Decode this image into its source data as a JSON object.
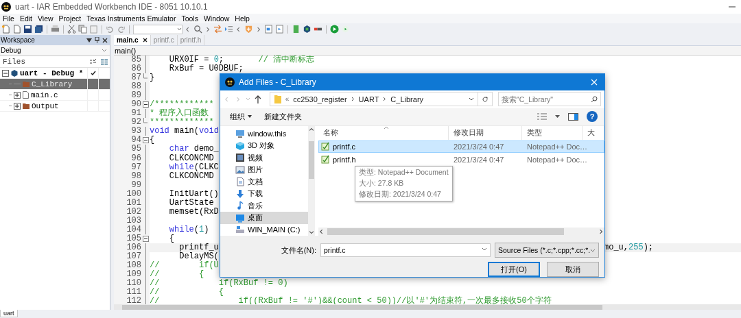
{
  "window": {
    "title": "uart - IAR Embedded Workbench IDE - 8051 10.10.1"
  },
  "menu": [
    "File",
    "Edit",
    "View",
    "Project",
    "Texas Instruments Emulator",
    "Tools",
    "Window",
    "Help"
  ],
  "workspace": {
    "title": "Workspace",
    "configuration": "Debug",
    "files_header": "Files",
    "tree": [
      {
        "label": "uart - Debug *",
        "kind": "project",
        "selected": false,
        "checked": true,
        "expanded": true,
        "children": [
          {
            "label": "C_Library",
            "kind": "folder",
            "selected": true,
            "checked": false
          },
          {
            "label": "main.c",
            "kind": "file",
            "selected": false,
            "checked": false,
            "expanded": false
          },
          {
            "label": "Output",
            "kind": "folder",
            "selected": false,
            "checked": false,
            "expanded": false
          }
        ]
      }
    ]
  },
  "editor": {
    "tabs": [
      {
        "label": "main.c",
        "selected": true
      },
      {
        "label": "printf.c",
        "selected": false
      },
      {
        "label": "printf.h",
        "selected": false
      }
    ],
    "function": "main()",
    "lines": [
      {
        "number": "85",
        "current": false,
        "fold_open": false,
        "fold_end": false,
        "segments": [
          {
            "text": "    URX0IF = ",
            "kind": "code"
          },
          {
            "text": "0",
            "kind": "number"
          },
          {
            "text": ";",
            "kind": "code"
          },
          {
            "text": "       // 清中断标志",
            "kind": "comment"
          }
        ]
      },
      {
        "number": "86",
        "current": false,
        "fold_open": false,
        "fold_end": false,
        "segments": [
          {
            "text": "    RxBuf = U0DBUF;",
            "kind": "code"
          }
        ]
      },
      {
        "number": "87",
        "current": false,
        "fold_open": false,
        "fold_end": true,
        "segments": [
          {
            "text": "}",
            "kind": "code"
          }
        ]
      },
      {
        "number": "88",
        "current": false,
        "fold_open": false,
        "fold_end": false
      },
      {
        "number": "89",
        "current": false,
        "fold_open": false,
        "fold_end": false
      },
      {
        "number": "90",
        "current": false,
        "fold_open": true,
        "fold_end": false,
        "segments": [
          {
            "text": "/************",
            "kind": "comment"
          }
        ]
      },
      {
        "number": "91",
        "current": false,
        "fold_open": false,
        "fold_end": false,
        "segments": [
          {
            "text": "* 程序入口函数",
            "kind": "comment"
          }
        ]
      },
      {
        "number": "92",
        "current": false,
        "fold_open": false,
        "fold_end": true,
        "segments": [
          {
            "text": "*************",
            "kind": "comment"
          }
        ]
      },
      {
        "number": "93",
        "current": false,
        "fold_open": false,
        "fold_end": false,
        "segments": [
          {
            "text": "void",
            "kind": "keyword"
          },
          {
            "text": " main(",
            "kind": "code"
          },
          {
            "text": "void",
            "kind": "keyword"
          }
        ]
      },
      {
        "number": "94",
        "current": false,
        "fold_open": true,
        "fold_end": false,
        "segments": [
          {
            "text": "{",
            "kind": "code"
          }
        ]
      },
      {
        "number": "95",
        "current": false,
        "fold_open": false,
        "fold_end": false,
        "segments": [
          {
            "text": "    char",
            "kind": "keyword"
          },
          {
            "text": " demo_",
            "kind": "code"
          }
        ]
      },
      {
        "number": "96",
        "current": false,
        "fold_open": false,
        "fold_end": false,
        "segments": [
          {
            "text": "    CLKCONCMD",
            "kind": "code"
          }
        ]
      },
      {
        "number": "97",
        "current": false,
        "fold_open": false,
        "fold_end": false,
        "segments": [
          {
            "text": "    while",
            "kind": "keyword"
          },
          {
            "text": "(CLKC",
            "kind": "code"
          }
        ]
      },
      {
        "number": "98",
        "current": false,
        "fold_open": false,
        "fold_end": false,
        "segments": [
          {
            "text": "    CLKCONCMD",
            "kind": "code"
          }
        ]
      },
      {
        "number": "99",
        "current": false,
        "fold_open": false,
        "fold_end": false
      },
      {
        "number": "100",
        "current": false,
        "fold_open": false,
        "fold_end": false,
        "segments": [
          {
            "text": "    InitUart()",
            "kind": "code"
          }
        ]
      },
      {
        "number": "101",
        "current": false,
        "fold_open": false,
        "fold_end": false,
        "segments": [
          {
            "text": "    UartState",
            "kind": "code"
          }
        ]
      },
      {
        "number": "102",
        "current": false,
        "fold_open": false,
        "fold_end": false,
        "segments": [
          {
            "text": "    memset(RxD",
            "kind": "code"
          }
        ]
      },
      {
        "number": "103",
        "current": false,
        "fold_open": false,
        "fold_end": false
      },
      {
        "number": "104",
        "current": false,
        "fold_open": false,
        "fold_end": false,
        "segments": [
          {
            "text": "    while",
            "kind": "keyword"
          },
          {
            "text": "(",
            "kind": "code"
          },
          {
            "text": "1",
            "kind": "number"
          },
          {
            "text": ")",
            "kind": "code"
          }
        ]
      },
      {
        "number": "105",
        "current": false,
        "fold_open": true,
        "fold_end": false,
        "segments": [
          {
            "text": "    {",
            "kind": "code"
          }
        ]
      },
      {
        "number": "106",
        "current": true,
        "fold_open": false,
        "fold_end": false,
        "segments": [
          {
            "text": "      printf_u",
            "kind": "code"
          }
        ],
        "tail": [
          {
            "text": "mo_u,",
            "kind": "code"
          },
          {
            "text": "255",
            "kind": "number"
          },
          {
            "text": ");",
            "kind": "code"
          }
        ]
      },
      {
        "number": "107",
        "current": false,
        "fold_open": false,
        "fold_end": false,
        "segments": [
          {
            "text": "      DelayMS(",
            "kind": "code"
          }
        ]
      },
      {
        "number": "108",
        "current": false,
        "fold_open": false,
        "fold_end": false,
        "segments": [
          {
            "text": "//        if(U",
            "kind": "comment"
          }
        ]
      },
      {
        "number": "109",
        "current": false,
        "fold_open": false,
        "fold_end": false,
        "segments": [
          {
            "text": "//        {",
            "kind": "comment"
          }
        ]
      },
      {
        "number": "110",
        "current": false,
        "fold_open": false,
        "fold_end": false,
        "segments": [
          {
            "text": "//            if(RxBuf != 0)",
            "kind": "comment"
          }
        ]
      },
      {
        "number": "111",
        "current": false,
        "fold_open": false,
        "fold_end": false,
        "segments": [
          {
            "text": "//            {",
            "kind": "comment"
          }
        ]
      },
      {
        "number": "112",
        "current": false,
        "fold_open": false,
        "fold_end": false,
        "segments": [
          {
            "text": "//                if((RxBuf != '#')&&(count < 50))//以'#'为结束符,一次最多接收50个字符",
            "kind": "comment"
          }
        ]
      }
    ]
  },
  "dialog": {
    "title": "Add Files - C_Library",
    "path": {
      "overflow": "«",
      "crumbs": [
        "cc2530_register",
        "UART",
        "C_Library"
      ]
    },
    "search": {
      "placeholder": "搜索\"C_Library\""
    },
    "toolbar": [
      {
        "label": "组织",
        "menu": true
      },
      {
        "label": "新建文件夹",
        "menu": false
      }
    ],
    "help": "?",
    "nav": [
      {
        "label": "window.this",
        "kind": "pc",
        "selected": false
      },
      {
        "label": "3D 对象",
        "kind": "objects",
        "selected": false
      },
      {
        "label": "视频",
        "kind": "video",
        "selected": false
      },
      {
        "label": "图片",
        "kind": "pictures",
        "selected": false
      },
      {
        "label": "文档",
        "kind": "documents",
        "selected": false
      },
      {
        "label": "下载",
        "kind": "downloads",
        "selected": false
      },
      {
        "label": "音乐",
        "kind": "music",
        "selected": false
      },
      {
        "label": "桌面",
        "kind": "desktop",
        "selected": true
      },
      {
        "label": "WIN_MAIN (C:)",
        "kind": "drive",
        "selected": false
      }
    ],
    "columns": [
      "名称",
      "修改日期",
      "类型",
      "大"
    ],
    "files": [
      {
        "name": "printf.c",
        "modified": "2021/3/24 0:47",
        "type": "Notepad++ Doc…",
        "selected": true
      },
      {
        "name": "printf.h",
        "modified": "2021/3/24 0:47",
        "type": "Notepad++ Doc…",
        "selected": false
      }
    ],
    "tooltip": [
      "类型: Notepad++ Document",
      "大小: 27.8 KB",
      "修改日期: 2021/3/24 0:47"
    ],
    "file_name": {
      "label": "文件名(N):",
      "value": "printf.c"
    },
    "filter": "Source Files (*.c;*.cpp;*.cc;*.",
    "buttons": [
      {
        "label": "打开(O)",
        "default": true
      },
      {
        "label": "取消",
        "default": false
      }
    ]
  },
  "status_bar": {
    "tabs": [
      {
        "label": "uart",
        "selected": true
      }
    ]
  }
}
